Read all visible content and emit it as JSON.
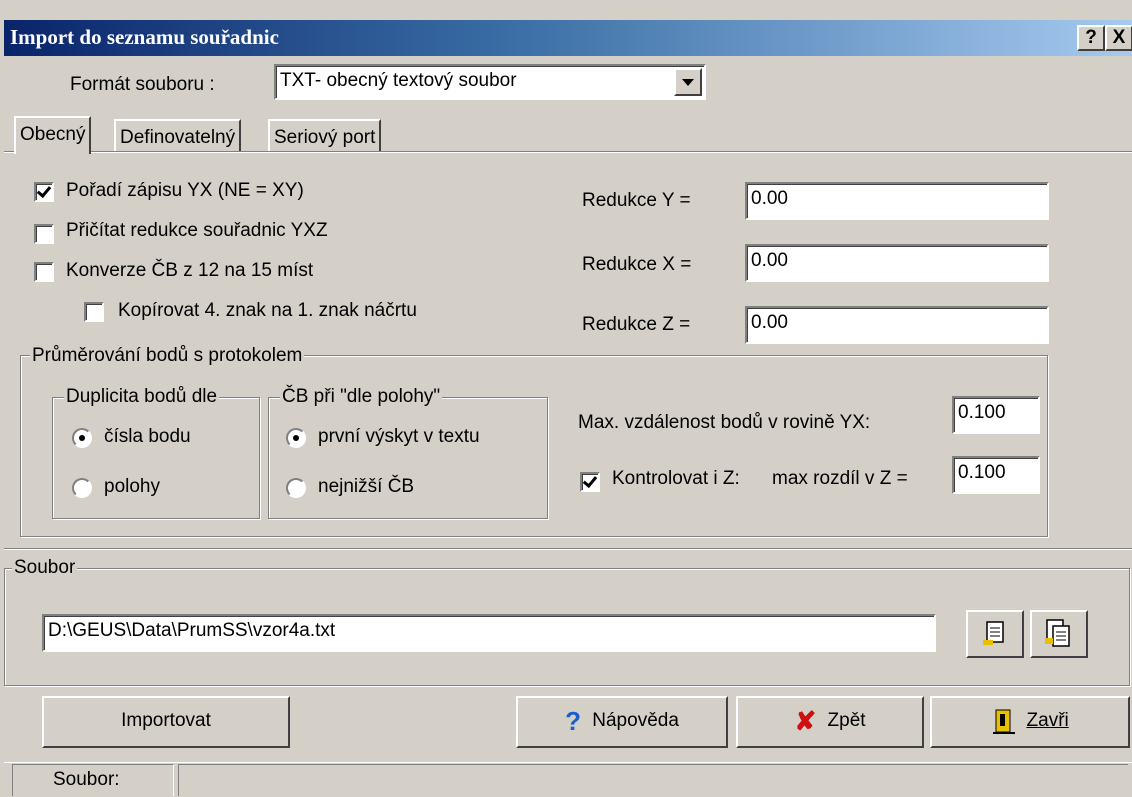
{
  "window": {
    "title": "Import do seznamu souřadnic",
    "help_button": "?",
    "close_button": "X"
  },
  "format": {
    "label": "Formát souboru :",
    "value": "TXT- obecný textový soubor"
  },
  "tabs": [
    {
      "label": "Obecný"
    },
    {
      "label": "Definovatelný"
    },
    {
      "label": "Seriový port"
    }
  ],
  "options": {
    "order_yx": {
      "label": "Pořadí zápisu YX (NE = XY)",
      "checked": true
    },
    "add_reduction": {
      "label": "Přičítat redukce souřadnic YXZ",
      "checked": false
    },
    "convert_cb": {
      "label": "Konverze ČB z 12 na 15 míst",
      "checked": false
    },
    "copy_char": {
      "label": "Kopírovat 4. znak na 1. znak náčrtu",
      "checked": false
    }
  },
  "reductions": {
    "y": {
      "label": "Redukce Y =",
      "value": "0.00"
    },
    "x": {
      "label": "Redukce X =",
      "value": "0.00"
    },
    "z": {
      "label": "Redukce Z =",
      "value": "0.00"
    }
  },
  "averaging": {
    "title": "Průměrování bodů s protokolem",
    "duplicity": {
      "title": "Duplicita bodů dle",
      "options": [
        "čísla bodu",
        "polohy"
      ],
      "selected": "čísla bodu"
    },
    "cb_position": {
      "title": "ČB při \"dle polohy\"",
      "options": [
        "první výskyt v textu",
        "nejnižší ČB"
      ],
      "selected": "první výskyt v textu"
    },
    "max_distance": {
      "label": "Max. vzdálenost bodů v rovině YX:",
      "value": "0.100"
    },
    "check_z": {
      "label": "Kontrolovat i  Z:",
      "checked": true,
      "diff_label": "max rozdíl v Z =",
      "value": "0.100"
    }
  },
  "file": {
    "title": "Soubor",
    "path": "D:\\GEUS\\Data\\PrumSS\\vzor4a.txt"
  },
  "buttons": {
    "import": "Importovat",
    "help": "Nápověda",
    "back": "Zpět",
    "close": "Zavři"
  },
  "status": {
    "label": "Soubor:"
  },
  "colors": {
    "titlebar_start": "#0a246a",
    "titlebar_end": "#a6caf0",
    "face": "#d4d0c8",
    "help_icon": "#1a5fd0",
    "back_icon": "#d01010"
  }
}
